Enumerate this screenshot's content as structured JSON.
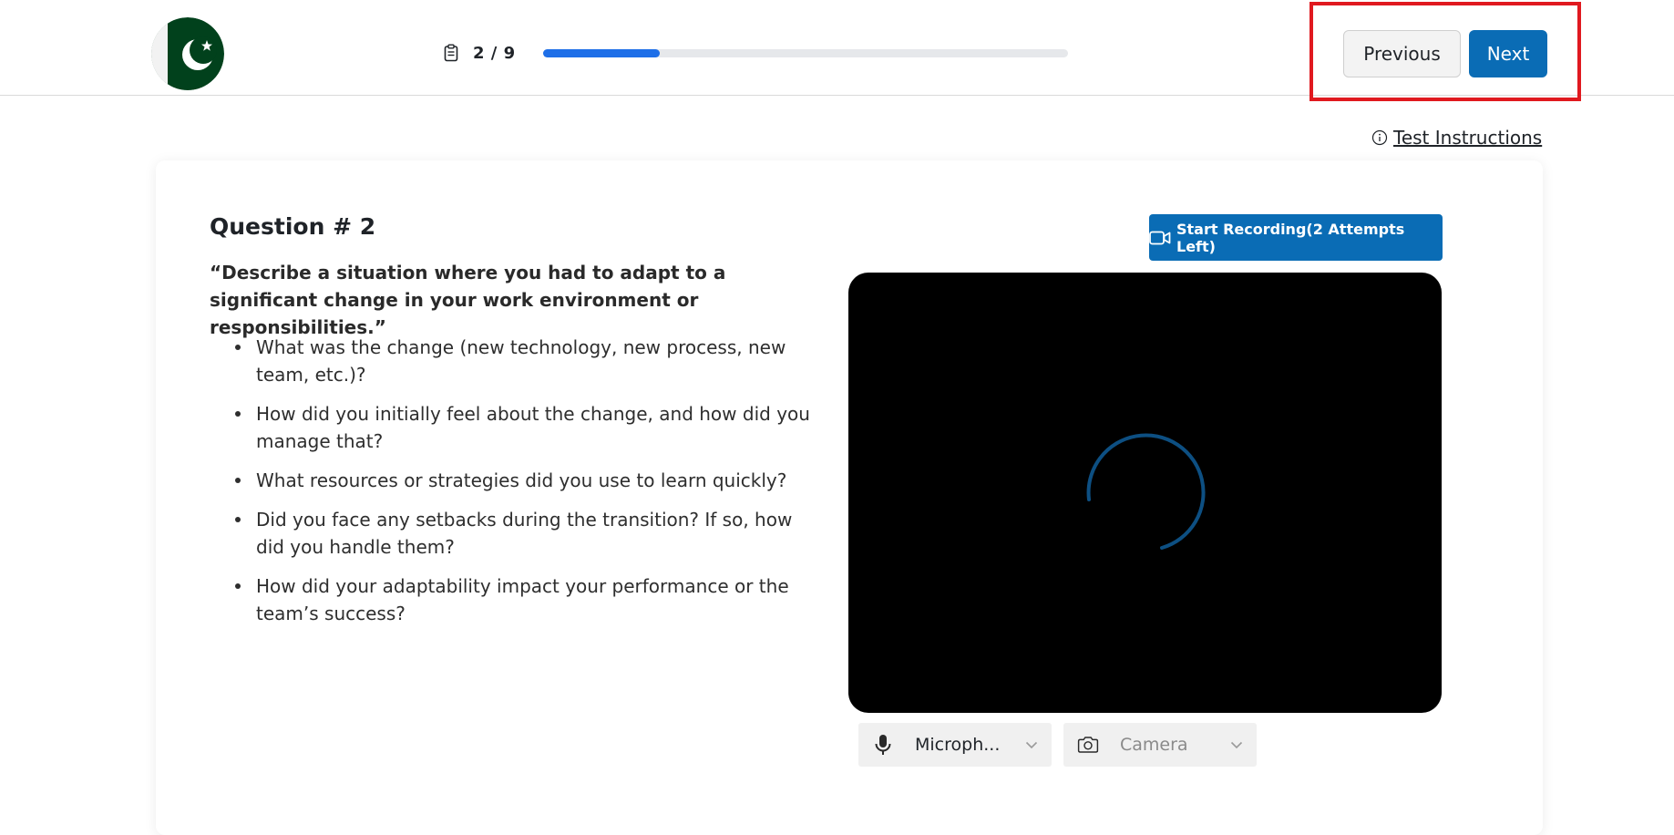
{
  "header": {
    "progress": {
      "text": "2 / 9",
      "current": 2,
      "total": 9,
      "fraction": 0.222
    },
    "previous_label": "Previous",
    "next_label": "Next"
  },
  "instructions_link": "Test Instructions",
  "question": {
    "title": "Question # 2",
    "prompt": "“Describe a situation where you had to adapt to a significant change in your work environment or responsibilities.”",
    "bullets": [
      "What was the change (new technology, new process, new team, etc.)?",
      "How did you initially feel about the change, and how did you manage that?",
      "What resources or strategies did you use to learn quickly?",
      "Did you face any setbacks during the transition? If so, how did you handle them?",
      "How did your adaptability impact your performance or the team’s success?"
    ]
  },
  "recording": {
    "button_label": "Start Recording(2 Attempts Left)"
  },
  "devices": {
    "microphone_label": "Microph...",
    "camera_label": "Camera"
  },
  "colors": {
    "primary": "#0a6cb5",
    "progress_fill": "#1e6fe8",
    "highlight": "#e0191f",
    "flag_green": "#01411c"
  },
  "icons": {
    "logo": "pakistan-flag-logo",
    "progress": "clipboard-icon",
    "info": "info-icon",
    "record": "video-camera-icon",
    "spinner": "loading-spinner",
    "microphone": "microphone-icon",
    "camera": "camera-icon",
    "dropdown": "chevron-down-icon"
  }
}
